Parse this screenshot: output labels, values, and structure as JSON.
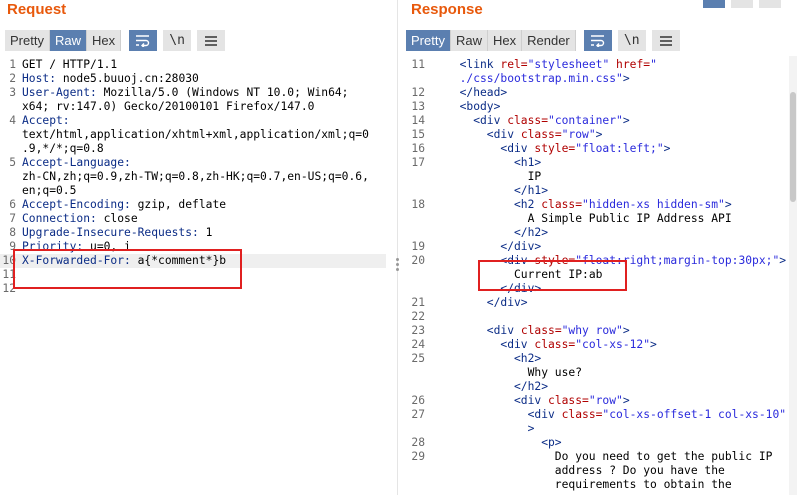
{
  "request": {
    "title": "Request",
    "buttons": [
      "Pretty",
      "Raw",
      "Hex"
    ],
    "active_button": "Raw",
    "icons": [
      "wrap-icon",
      "newline-icon",
      "menu-icon"
    ],
    "lines": [
      {
        "n": "1",
        "parts": [
          {
            "t": "GET / HTTP/1.1",
            "c": "txt"
          }
        ]
      },
      {
        "n": "2",
        "parts": [
          {
            "t": "Host:",
            "c": "k"
          },
          {
            "t": " node5.buuoj.cn:28030",
            "c": "txt"
          }
        ]
      },
      {
        "n": "3",
        "parts": [
          {
            "t": "User-Agent:",
            "c": "k"
          },
          {
            "t": " Mozilla/5.0 (Windows NT 10.0; Win64;",
            "c": "txt"
          }
        ]
      },
      {
        "n": "",
        "parts": [
          {
            "t": "x64; rv:147.0) Gecko/20100101 Firefox/147.0",
            "c": "txt"
          }
        ]
      },
      {
        "n": "4",
        "parts": [
          {
            "t": "Accept:",
            "c": "k"
          }
        ]
      },
      {
        "n": "",
        "parts": [
          {
            "t": "text/html,application/xhtml+xml,application/xml;q=0",
            "c": "txt"
          }
        ]
      },
      {
        "n": "",
        "parts": [
          {
            "t": ".9,*/*;q=0.8",
            "c": "txt"
          }
        ]
      },
      {
        "n": "5",
        "parts": [
          {
            "t": "Accept-Language:",
            "c": "k"
          }
        ]
      },
      {
        "n": "",
        "parts": [
          {
            "t": "zh-CN,zh;q=0.9,zh-TW;q=0.8,zh-HK;q=0.7,en-US;q=0.6,",
            "c": "txt"
          }
        ]
      },
      {
        "n": "",
        "parts": [
          {
            "t": "en;q=0.5",
            "c": "txt"
          }
        ]
      },
      {
        "n": "6",
        "parts": [
          {
            "t": "Accept-Encoding:",
            "c": "k"
          },
          {
            "t": " gzip, deflate",
            "c": "txt"
          }
        ]
      },
      {
        "n": "7",
        "parts": [
          {
            "t": "Connection:",
            "c": "k"
          },
          {
            "t": " close",
            "c": "txt"
          }
        ]
      },
      {
        "n": "8",
        "parts": [
          {
            "t": "Upgrade-Insecure-Requests:",
            "c": "k"
          },
          {
            "t": " 1",
            "c": "txt"
          }
        ]
      },
      {
        "n": "9",
        "parts": [
          {
            "t": "Priority:",
            "c": "k"
          },
          {
            "t": " u=0, i",
            "c": "txt"
          }
        ]
      },
      {
        "n": "10",
        "parts": [
          {
            "t": "X-Forwarded-For:",
            "c": "k"
          },
          {
            "t": " a{*comment*}b",
            "c": "txt"
          }
        ]
      },
      {
        "n": "11",
        "parts": []
      },
      {
        "n": "12",
        "parts": []
      }
    ]
  },
  "response": {
    "title": "Response",
    "buttons": [
      "Pretty",
      "Raw",
      "Hex",
      "Render"
    ],
    "active_button": "Pretty",
    "icons": [
      "wrap-icon",
      "newline-icon",
      "menu-icon"
    ],
    "lines": [
      {
        "n": "11",
        "i": 1,
        "parts": [
          {
            "t": "<link ",
            "c": "tag"
          },
          {
            "t": "rel=",
            "c": "attr"
          },
          {
            "t": "\"stylesheet\" ",
            "c": "str"
          },
          {
            "t": "href=",
            "c": "attr"
          },
          {
            "t": "\"",
            "c": "str"
          }
        ]
      },
      {
        "n": "",
        "i": 1,
        "parts": [
          {
            "t": "./css/bootstrap.min.css\"",
            "c": "str"
          },
          {
            "t": ">",
            "c": "tag"
          }
        ]
      },
      {
        "n": "12",
        "i": 1,
        "parts": [
          {
            "t": "</head>",
            "c": "tag"
          }
        ]
      },
      {
        "n": "13",
        "i": 1,
        "parts": [
          {
            "t": "<body>",
            "c": "tag"
          }
        ]
      },
      {
        "n": "14",
        "i": 2,
        "parts": [
          {
            "t": "<div ",
            "c": "tag"
          },
          {
            "t": "class=",
            "c": "attr"
          },
          {
            "t": "\"container\"",
            "c": "str"
          },
          {
            "t": ">",
            "c": "tag"
          }
        ]
      },
      {
        "n": "15",
        "i": 3,
        "parts": [
          {
            "t": "<div ",
            "c": "tag"
          },
          {
            "t": "class=",
            "c": "attr"
          },
          {
            "t": "\"row\"",
            "c": "str"
          },
          {
            "t": ">",
            "c": "tag"
          }
        ]
      },
      {
        "n": "16",
        "i": 4,
        "parts": [
          {
            "t": "<div ",
            "c": "tag"
          },
          {
            "t": "style=",
            "c": "attr"
          },
          {
            "t": "\"float:left;\"",
            "c": "str"
          },
          {
            "t": ">",
            "c": "tag"
          }
        ]
      },
      {
        "n": "17",
        "i": 5,
        "parts": [
          {
            "t": "<h1>",
            "c": "tag"
          }
        ]
      },
      {
        "n": "",
        "i": 6,
        "parts": [
          {
            "t": "IP",
            "c": "txt"
          }
        ]
      },
      {
        "n": "",
        "i": 5,
        "parts": [
          {
            "t": "</h1>",
            "c": "tag"
          }
        ]
      },
      {
        "n": "18",
        "i": 5,
        "parts": [
          {
            "t": "<h2 ",
            "c": "tag"
          },
          {
            "t": "class=",
            "c": "attr"
          },
          {
            "t": "\"hidden-xs hidden-sm\"",
            "c": "str"
          },
          {
            "t": ">",
            "c": "tag"
          }
        ]
      },
      {
        "n": "",
        "i": 6,
        "parts": [
          {
            "t": "A Simple Public IP Address API",
            "c": "txt"
          }
        ]
      },
      {
        "n": "",
        "i": 5,
        "parts": [
          {
            "t": "</h2>",
            "c": "tag"
          }
        ]
      },
      {
        "n": "19",
        "i": 4,
        "parts": [
          {
            "t": "</div>",
            "c": "tag"
          }
        ]
      },
      {
        "n": "20",
        "i": 4,
        "parts": [
          {
            "t": "<div ",
            "c": "tag"
          },
          {
            "t": "style=",
            "c": "attr"
          },
          {
            "t": "\"float:right;margin-top:30px;\"",
            "c": "str"
          },
          {
            "t": ">",
            "c": "tag"
          }
        ]
      },
      {
        "n": "",
        "i": 5,
        "parts": [
          {
            "t": "Current IP:ab",
            "c": "txt"
          }
        ]
      },
      {
        "n": "",
        "i": 4,
        "parts": [
          {
            "t": "</div>",
            "c": "tag"
          }
        ]
      },
      {
        "n": "21",
        "i": 3,
        "parts": [
          {
            "t": "</div>",
            "c": "tag"
          }
        ]
      },
      {
        "n": "22",
        "i": 0,
        "parts": []
      },
      {
        "n": "23",
        "i": 3,
        "parts": [
          {
            "t": "<div ",
            "c": "tag"
          },
          {
            "t": "class=",
            "c": "attr"
          },
          {
            "t": "\"why row\"",
            "c": "str"
          },
          {
            "t": ">",
            "c": "tag"
          }
        ]
      },
      {
        "n": "24",
        "i": 4,
        "parts": [
          {
            "t": "<div ",
            "c": "tag"
          },
          {
            "t": "class=",
            "c": "attr"
          },
          {
            "t": "\"col-xs-12\"",
            "c": "str"
          },
          {
            "t": ">",
            "c": "tag"
          }
        ]
      },
      {
        "n": "25",
        "i": 5,
        "parts": [
          {
            "t": "<h2>",
            "c": "tag"
          }
        ]
      },
      {
        "n": "",
        "i": 6,
        "parts": [
          {
            "t": "Why use?",
            "c": "txt"
          }
        ]
      },
      {
        "n": "",
        "i": 5,
        "parts": [
          {
            "t": "</h2>",
            "c": "tag"
          }
        ]
      },
      {
        "n": "26",
        "i": 5,
        "parts": [
          {
            "t": "<div ",
            "c": "tag"
          },
          {
            "t": "class=",
            "c": "attr"
          },
          {
            "t": "\"row\"",
            "c": "str"
          },
          {
            "t": ">",
            "c": "tag"
          }
        ]
      },
      {
        "n": "27",
        "i": 6,
        "parts": [
          {
            "t": "<div ",
            "c": "tag"
          },
          {
            "t": "class=",
            "c": "attr"
          },
          {
            "t": "\"col-xs-offset-1 col-xs-10\"",
            "c": "str"
          }
        ]
      },
      {
        "n": "",
        "i": 6,
        "parts": [
          {
            "t": ">",
            "c": "tag"
          }
        ]
      },
      {
        "n": "28",
        "i": 7,
        "parts": [
          {
            "t": "<p>",
            "c": "tag"
          }
        ]
      },
      {
        "n": "29",
        "i": 8,
        "parts": [
          {
            "t": "Do you need to get the public IP",
            "c": "txt"
          }
        ]
      },
      {
        "n": "",
        "i": 8,
        "parts": [
          {
            "t": "address ? Do you have the",
            "c": "txt"
          }
        ]
      },
      {
        "n": "",
        "i": 8,
        "parts": [
          {
            "t": "requirements to obtain the",
            "c": "txt"
          }
        ]
      }
    ]
  }
}
